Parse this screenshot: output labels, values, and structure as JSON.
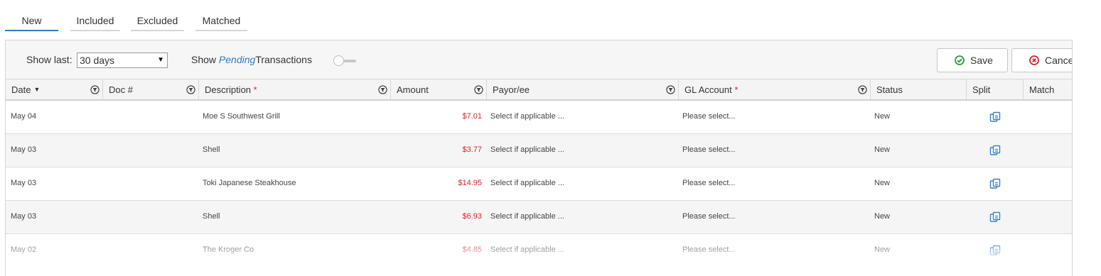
{
  "tabs": [
    {
      "label": "New",
      "active": true
    },
    {
      "label": "Included",
      "active": false
    },
    {
      "label": "Excluded",
      "active": false
    },
    {
      "label": "Matched",
      "active": false
    }
  ],
  "toolbar": {
    "show_last_label": "Show last:",
    "show_last_value": "30 days",
    "show_pending_prefix": "Show",
    "show_pending_word": "Pending",
    "show_pending_suffix": "Transactions",
    "pending_toggle_on": false,
    "save_label": "Save",
    "cancel_label": "Cancel"
  },
  "columns": {
    "date": "Date",
    "doc": "Doc #",
    "description": "Description",
    "amount": "Amount",
    "payee": "Payor/ee",
    "gl_account": "GL Account",
    "status": "Status",
    "split": "Split",
    "match": "Match",
    "required_mark": "*",
    "sort_mark": "▼"
  },
  "rows": [
    {
      "date": "May 04",
      "doc": "",
      "description": "Moe S Southwest Grill",
      "amount": "$7.01",
      "payee": "Select if applicable ...",
      "gl_account": "Please select...",
      "status": "New"
    },
    {
      "date": "May 03",
      "doc": "",
      "description": "Shell",
      "amount": "$3.77",
      "payee": "Select if applicable ...",
      "gl_account": "Please select...",
      "status": "New"
    },
    {
      "date": "May 03",
      "doc": "",
      "description": "Toki Japanese Steakhouse",
      "amount": "$14.95",
      "payee": "Select if applicable ...",
      "gl_account": "Please select...",
      "status": "New"
    },
    {
      "date": "May 03",
      "doc": "",
      "description": "Shell",
      "amount": "$6.93",
      "payee": "Select if applicable ...",
      "gl_account": "Please select...",
      "status": "New"
    },
    {
      "date": "May 02",
      "doc": "",
      "description": "The Kroger Co",
      "amount": "$4.85",
      "payee": "Select if applicable ...",
      "gl_account": "Please select...",
      "status": "New"
    }
  ],
  "colors": {
    "accent": "#2e7bc4",
    "amount": "#d9262c",
    "save_icon": "#2a9d3a",
    "cancel_icon": "#d9262c"
  },
  "icons": {
    "save": "check-circle-icon",
    "cancel": "x-circle-icon",
    "filter": "filter-icon",
    "split": "split-copy-icon"
  }
}
